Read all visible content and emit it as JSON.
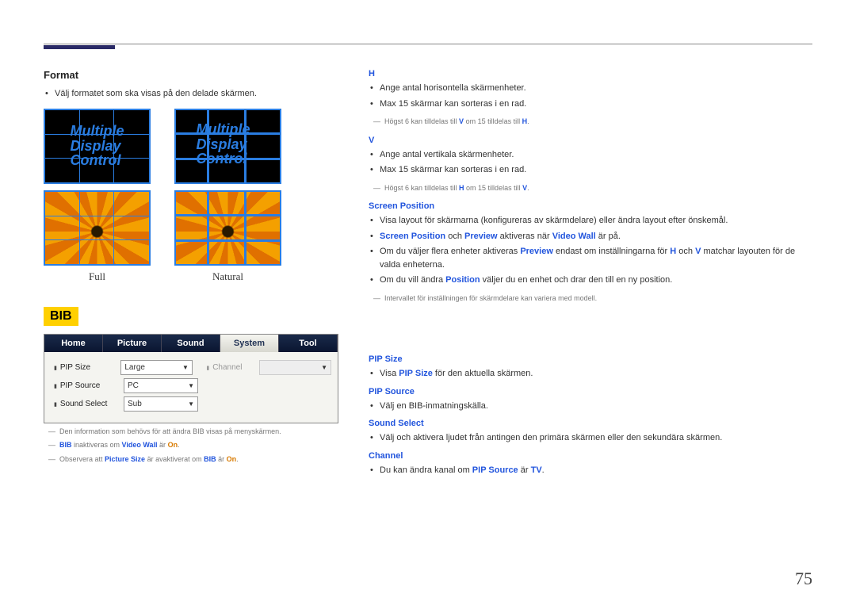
{
  "header": {
    "page_number": "75"
  },
  "left": {
    "format": {
      "title": "Format",
      "bullet1": "Välj formatet som ska visas på den delade skärmen.",
      "mdc_line1": "Multiple",
      "mdc_line2": "Display",
      "mdc_line3": "Control",
      "caption_full": "Full",
      "caption_natural": "Natural"
    },
    "bib": {
      "tag": "BIB",
      "tabs": {
        "home": "Home",
        "picture": "Picture",
        "sound": "Sound",
        "system": "System",
        "tool": "Tool"
      },
      "rows": {
        "pip_size_label": "PIP Size",
        "pip_size_value": "Large",
        "channel_label": "Channel",
        "pip_source_label": "PIP Source",
        "pip_source_value": "PC",
        "sound_select_label": "Sound Select",
        "sound_select_value": "Sub"
      },
      "note1_pre": "Den information som behövs för att ändra BIB visas på menyskärmen.",
      "note2_a": "BIB",
      "note2_b": " inaktiveras om ",
      "note2_c": "Video Wall",
      "note2_d": " är ",
      "note2_e": "On",
      "note2_f": ".",
      "note3_a": "Observera att ",
      "note3_b": "Picture Size",
      "note3_c": " är avaktiverat om ",
      "note3_d": "BIB",
      "note3_e": " är ",
      "note3_f": "On",
      "note3_g": "."
    }
  },
  "right": {
    "h": {
      "title": "H",
      "b1": "Ange antal horisontella skärmenheter.",
      "b2": "Max 15 skärmar kan sorteras i en rad.",
      "note_a": "Högst 6 kan tilldelas till ",
      "note_b": "V",
      "note_c": " om 15 tilldelas till ",
      "note_d": "H",
      "note_e": "."
    },
    "v": {
      "title": "V",
      "b1": "Ange antal vertikala skärmenheter.",
      "b2": "Max 15 skärmar kan sorteras i en rad.",
      "note_a": "Högst 6 kan tilldelas till ",
      "note_b": "H",
      "note_c": " om 15 tilldelas till ",
      "note_d": "V",
      "note_e": "."
    },
    "screen_pos": {
      "title": "Screen Position",
      "b1": "Visa layout för skärmarna (konfigureras av skärmdelare) eller ändra layout efter önskemål.",
      "b2_a": "Screen Position",
      "b2_b": " och ",
      "b2_c": "Preview",
      "b2_d": " aktiveras när ",
      "b2_e": "Video Wall",
      "b2_f": " är på.",
      "b3_a": "Om du väljer flera enheter aktiveras ",
      "b3_b": "Preview",
      "b3_c": " endast om inställningarna för ",
      "b3_d": "H",
      "b3_e": " och ",
      "b3_f": "V",
      "b3_g": " matchar layouten för de valda enheterna.",
      "b4_a": "Om du vill ändra ",
      "b4_b": "Position",
      "b4_c": " väljer du en enhet och drar den till en ny position.",
      "note": "Intervallet för inställningen för skärmdelare kan variera med modell."
    },
    "pip_size": {
      "title": "PIP Size",
      "b1_a": "Visa ",
      "b1_b": "PIP Size",
      "b1_c": " för den aktuella skärmen."
    },
    "pip_source": {
      "title": "PIP Source",
      "b1": "Välj en BIB-inmatningskälla."
    },
    "sound_select": {
      "title": "Sound Select",
      "b1": "Välj och aktivera ljudet från antingen den primära skärmen eller den sekundära skärmen."
    },
    "channel": {
      "title": "Channel",
      "b1_a": "Du kan ändra kanal om ",
      "b1_b": "PIP Source",
      "b1_c": " är ",
      "b1_d": "TV",
      "b1_e": "."
    }
  }
}
